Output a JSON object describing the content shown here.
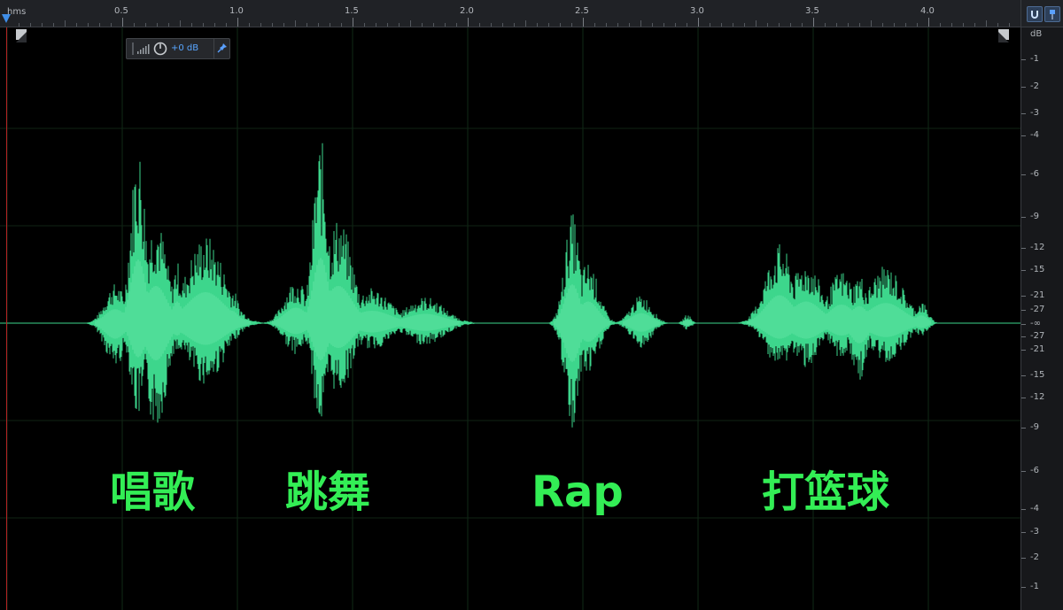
{
  "ruler": {
    "unit": "hms",
    "ticks": [
      "0.5",
      "1.0",
      "1.5",
      "2.0",
      "2.5",
      "3.0",
      "3.5",
      "4.0"
    ]
  },
  "hud": {
    "gain": "+0 dB"
  },
  "db_scale": {
    "unit": "dB",
    "labels": [
      "-1",
      "-2",
      "-3",
      "-4",
      "-6",
      "-9",
      "-12",
      "-15",
      "-21",
      "-27",
      "-∞",
      "-27",
      "-21",
      "-15",
      "-12",
      "-9",
      "-6",
      "-4",
      "-3",
      "-2",
      "-1"
    ]
  },
  "overlay_words": [
    "唱歌",
    "跳舞",
    "Rap",
    "打篮球"
  ],
  "colors": {
    "waveform": "#3dd68c",
    "waveform_bright": "#7ff0b8",
    "overlay_text": "#33ee55",
    "playhead": "#3f8ee8"
  },
  "icons": [
    "playhead-icon",
    "level-meter-icon",
    "gain-knob-icon",
    "pin-icon",
    "zoom-corner-icon",
    "snap-magnet-icon",
    "marker-pin-icon"
  ]
}
